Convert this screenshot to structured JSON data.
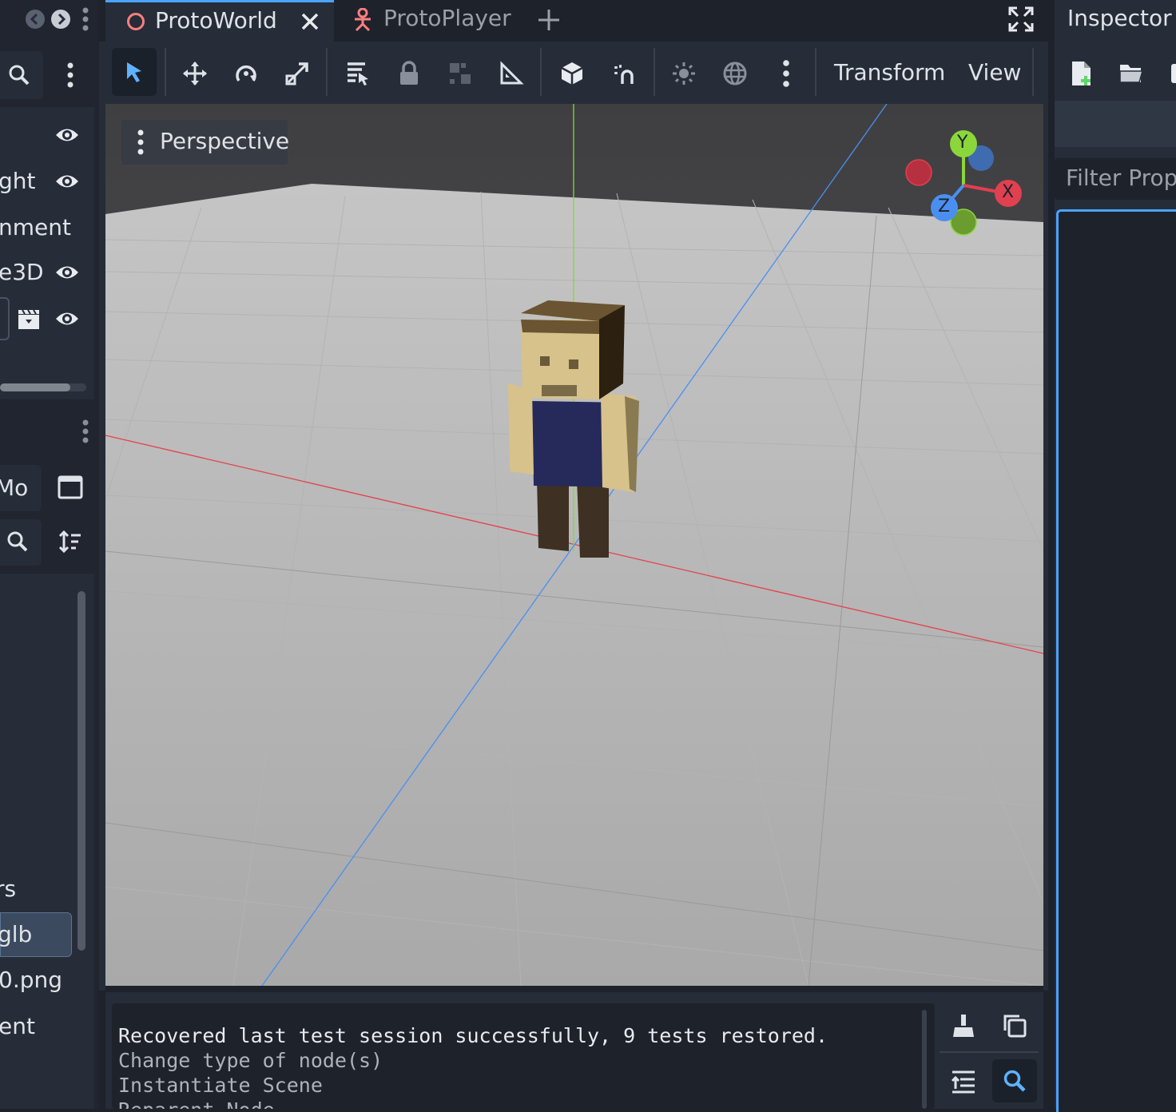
{
  "left_top": {
    "rows": [
      {
        "label": "",
        "eye": true
      },
      {
        "label": "ght",
        "eye": true
      },
      {
        "label": "nment",
        "eye": false
      },
      {
        "label": "e3D",
        "eye": true
      },
      {
        "label": "",
        "eye": true,
        "clapper": true
      }
    ]
  },
  "left_bottom": {
    "filter_value": "Mo",
    "files": [
      {
        "label": "rs",
        "selected": false
      },
      {
        "label": "glb",
        "selected": true
      },
      {
        "label": "0.png",
        "selected": false
      },
      {
        "label": "ent",
        "selected": false
      }
    ]
  },
  "tabs": [
    {
      "label": "ProtoWorld",
      "active": true,
      "closable": true
    },
    {
      "label": "ProtoPlayer",
      "active": false,
      "closable": false
    }
  ],
  "toolbar": {
    "menus": [
      "Transform",
      "View"
    ]
  },
  "viewport": {
    "perspective_label": "Perspective",
    "gizmo": {
      "y": "Y",
      "x": "X",
      "z": "Z"
    }
  },
  "output": {
    "lines": [
      "Recovered last test session successfully, 9 tests restored.",
      "Change type of node(s)",
      "Instantiate Scene",
      "Reparent Node"
    ]
  },
  "inspector": {
    "title": "Inspector",
    "filter_placeholder": "Filter Prope"
  },
  "colors": {
    "accent": "#4aa3ff",
    "axis_x": "#e0404f",
    "axis_y": "#8bd63b",
    "axis_z": "#4a8ff0"
  }
}
